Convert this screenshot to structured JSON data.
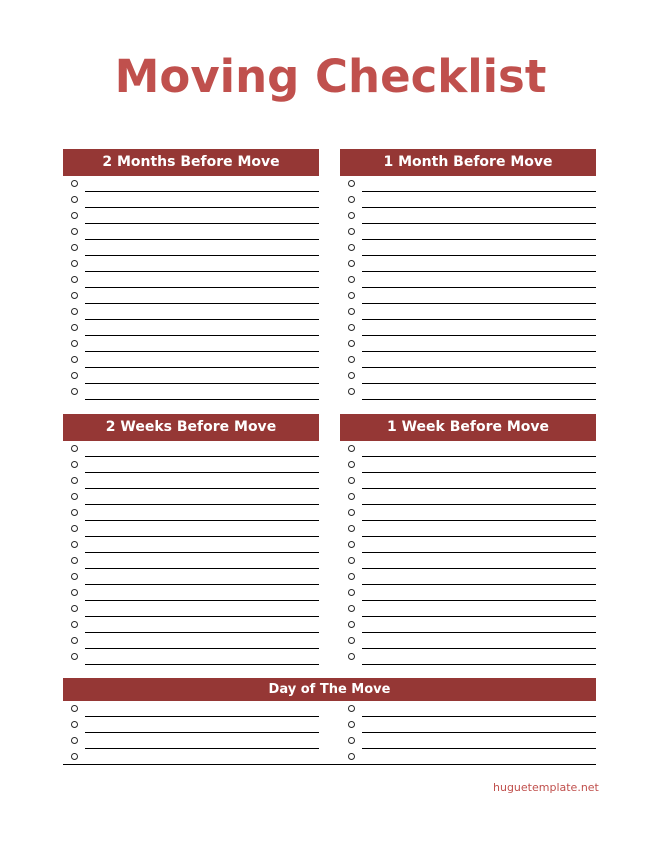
{
  "document": {
    "title": "Moving Checklist",
    "footer": "huguetemplate.net",
    "accent_color": "#953735",
    "title_color": "#c0504d"
  },
  "sections": [
    {
      "id": "two-months",
      "heading": "2 Months Before Move",
      "item_count": 14
    },
    {
      "id": "one-month",
      "heading": "1 Month Before Move",
      "item_count": 14
    },
    {
      "id": "two-weeks",
      "heading": "2 Weeks Before Move",
      "item_count": 14
    },
    {
      "id": "one-week",
      "heading": "1 Week Before Move",
      "item_count": 14
    }
  ],
  "day_of_move": {
    "heading": "Day of The Move",
    "columns": 2,
    "item_count_per_column": 4
  }
}
